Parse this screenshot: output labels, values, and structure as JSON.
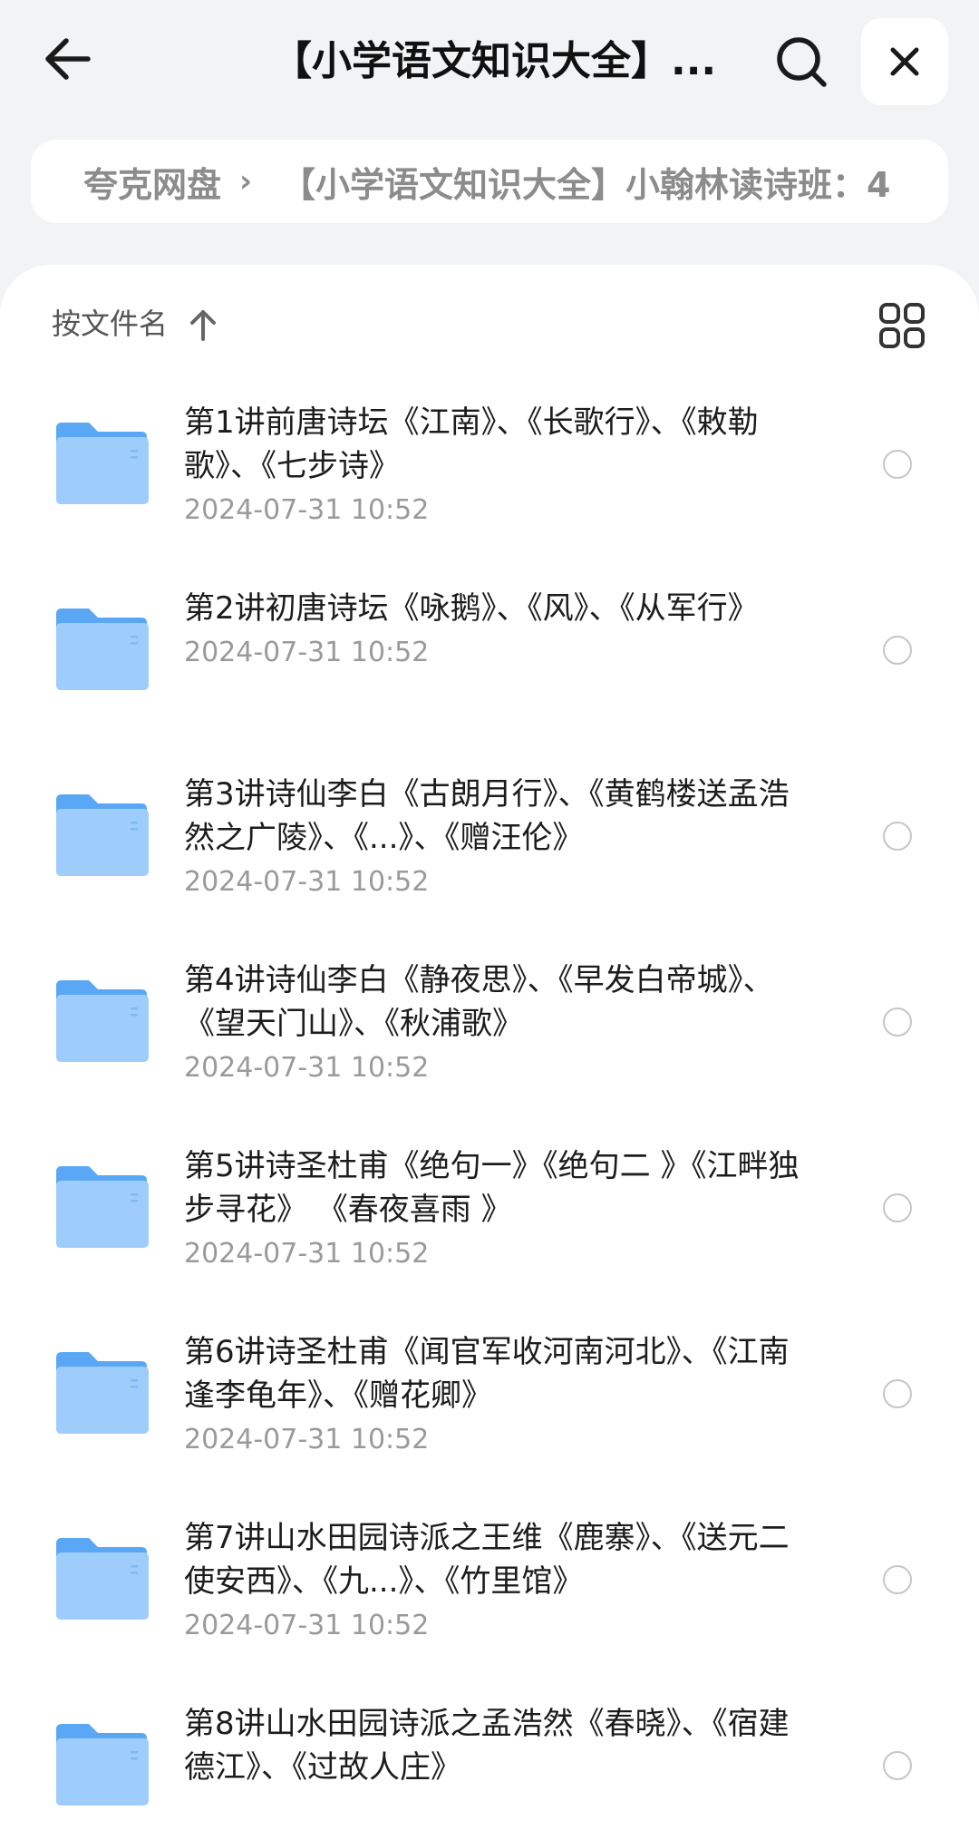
{
  "header": {
    "title": "【小学语文知识大全】...",
    "back_icon": "back-arrow-icon",
    "search_icon": "search-icon",
    "close_icon": "close-icon"
  },
  "breadcrumb": {
    "root": "夸克网盘",
    "separator": "›",
    "current": "【小学语文知识大全】小翰林读诗班：4"
  },
  "sort": {
    "label": "按文件名",
    "direction_icon": "arrow-up-icon",
    "view_icon": "grid-view-icon"
  },
  "files": [
    {
      "name": "第1讲前唐诗坛《江南》、《长歌行》、《敕勒歌》、《七步诗》",
      "date": "2024-07-31 10:52"
    },
    {
      "name": "第2讲初唐诗坛《咏鹅》、《风》、《从军行》",
      "date": "2024-07-31 10:52"
    },
    {
      "name": "第3讲诗仙李白《古朗月行》、《黄鹤楼送孟浩然之广陵》、《...》、《赠汪伦》",
      "date": "2024-07-31 10:52"
    },
    {
      "name": "第4讲诗仙李白《静夜思》、《早发白帝城》、《望天门山》、《秋浦歌》",
      "date": "2024-07-31 10:52"
    },
    {
      "name": "第5讲诗圣杜甫《绝句一》《绝句二 》《江畔独步寻花》 《春夜喜雨 》",
      "date": "2024-07-31 10:52"
    },
    {
      "name": "第6讲诗圣杜甫《闻官军收河南河北》、《江南逢李龟年》、《赠花卿》",
      "date": "2024-07-31 10:52"
    },
    {
      "name": "第7讲山水田园诗派之王维《鹿寨》、《送元二使安西》、《九...》、《竹里馆》",
      "date": "2024-07-31 10:52"
    },
    {
      "name": "第8讲山水田园诗派之孟浩然《春晓》、《宿建德江》、《过故人庄》",
      "date": ""
    }
  ],
  "colors": {
    "folder_top": "#5aa8f5",
    "folder_body": "#9fcdfb",
    "background": "#f2f3f5"
  }
}
